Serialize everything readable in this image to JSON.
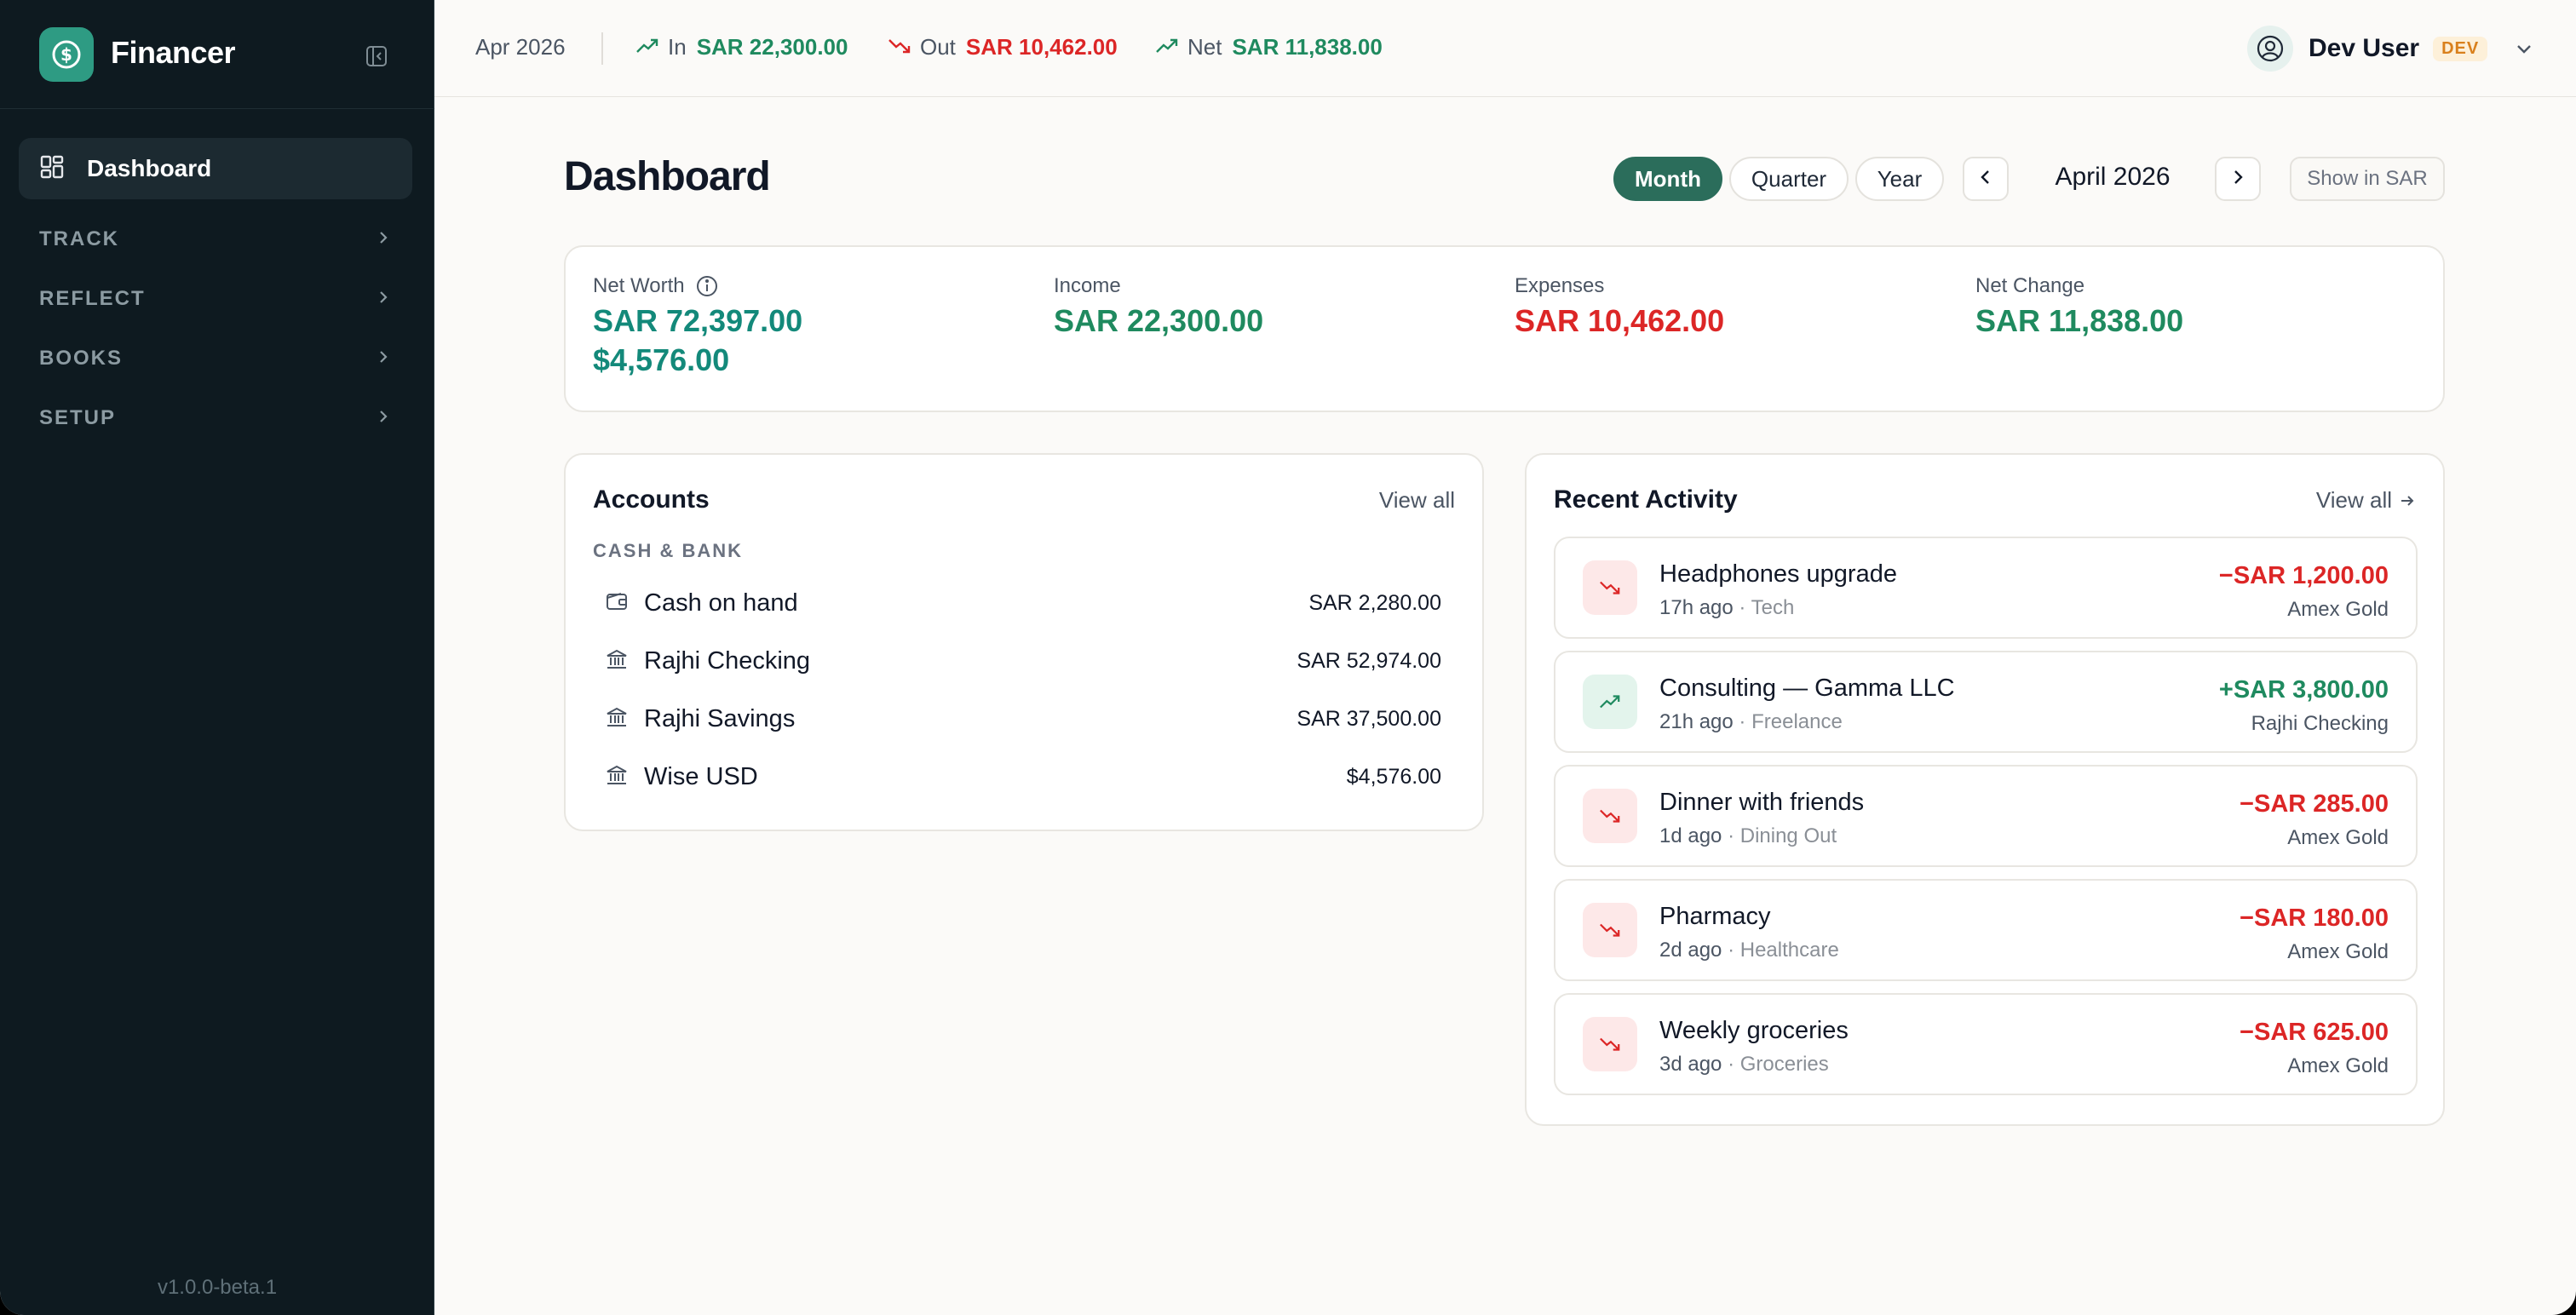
{
  "app": {
    "name": "Financer",
    "version": "v1.0.0-beta.1",
    "accent": "#2e9b83"
  },
  "sidebar": {
    "active_item": "Dashboard",
    "sections": [
      "TRACK",
      "REFLECT",
      "BOOKS",
      "SETUP"
    ]
  },
  "topbar": {
    "period": "Apr 2026",
    "in_label": "In",
    "in_value": "SAR 22,300.00",
    "out_label": "Out",
    "out_value": "SAR 10,462.00",
    "net_label": "Net",
    "net_value": "SAR 11,838.00",
    "user_name": "Dev User",
    "user_badge": "DEV"
  },
  "header": {
    "title": "Dashboard",
    "range_options": [
      "Month",
      "Quarter",
      "Year"
    ],
    "range_selected": "Month",
    "period_label": "April 2026",
    "currency_toggle": "Show in SAR"
  },
  "summary": {
    "net_worth_label": "Net Worth",
    "net_worth_values": [
      "SAR 72,397.00",
      "$4,576.00"
    ],
    "income_label": "Income",
    "income_value": "SAR 22,300.00",
    "expenses_label": "Expenses",
    "expenses_value": "SAR 10,462.00",
    "net_change_label": "Net Change",
    "net_change_value": "SAR 11,838.00"
  },
  "accounts": {
    "title": "Accounts",
    "view_all": "View all",
    "group": "CASH & BANK",
    "items": [
      {
        "name": "Cash on hand",
        "balance": "SAR 2,280.00",
        "icon": "wallet-icon"
      },
      {
        "name": "Rajhi Checking",
        "balance": "SAR 52,974.00",
        "icon": "bank-icon"
      },
      {
        "name": "Rajhi Savings",
        "balance": "SAR 37,500.00",
        "icon": "bank-icon"
      },
      {
        "name": "Wise USD",
        "balance": "$4,576.00",
        "icon": "bank-icon"
      }
    ]
  },
  "activity": {
    "title": "Recent Activity",
    "view_all": "View all",
    "items": [
      {
        "title": "Headphones upgrade",
        "time": "17h ago",
        "category": "Tech",
        "amount": "−SAR 1,200.00",
        "account": "Amex Gold",
        "direction": "out"
      },
      {
        "title": "Consulting — Gamma LLC",
        "time": "21h ago",
        "category": "Freelance",
        "amount": "+SAR 3,800.00",
        "account": "Rajhi Checking",
        "direction": "in"
      },
      {
        "title": "Dinner with friends",
        "time": "1d ago",
        "category": "Dining Out",
        "amount": "−SAR 285.00",
        "account": "Amex Gold",
        "direction": "out"
      },
      {
        "title": "Pharmacy",
        "time": "2d ago",
        "category": "Healthcare",
        "amount": "−SAR 180.00",
        "account": "Amex Gold",
        "direction": "out"
      },
      {
        "title": "Weekly groceries",
        "time": "3d ago",
        "category": "Groceries",
        "amount": "−SAR 625.00",
        "account": "Amex Gold",
        "direction": "out"
      }
    ]
  },
  "colors": {
    "positive": "#1f8a5f",
    "negative": "#dc2626",
    "teal": "#13897a",
    "sidebar_bg": "#0e1a20"
  }
}
